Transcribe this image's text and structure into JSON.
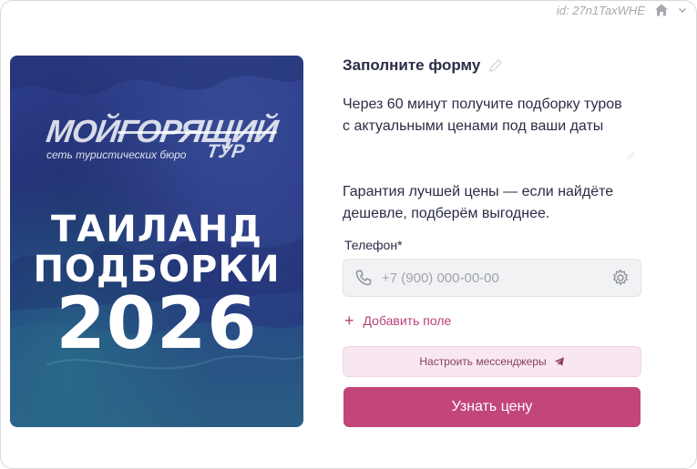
{
  "topbar": {
    "id_text": "id: 27n1TaxWHE",
    "icons": [
      "home-icon",
      "chevron-down-icon"
    ]
  },
  "banner": {
    "logo_line1_a": "МОЙ",
    "logo_line1_b": "ГОРЯЩИЙ",
    "logo_line2": "ТУР",
    "logo_tagline": "сеть туристических бюро",
    "headline_1": "ТАИЛАНД",
    "headline_2": "ПОДБОРКИ",
    "headline_3": "2026"
  },
  "form": {
    "title": "Заполните форму",
    "description_1": "Через 60 минут получите подборку туров с актуальными ценами под ваши даты",
    "description_2": "Гарантия лучшей цены — если найдёте дешевле, подберём выгоднее.",
    "phone_label": "Телефон*",
    "phone_placeholder": "+7 (900) 000-00-00",
    "add_field_label": "Добавить поле",
    "messengers_label": "Настроить мессенджеры",
    "submit_label": "Узнать цену"
  },
  "colors": {
    "accent": "#c3467b",
    "accent_light": "#f8e7f0",
    "text_dark": "#2a2d45",
    "banner_blue": "#2d3e8c"
  }
}
